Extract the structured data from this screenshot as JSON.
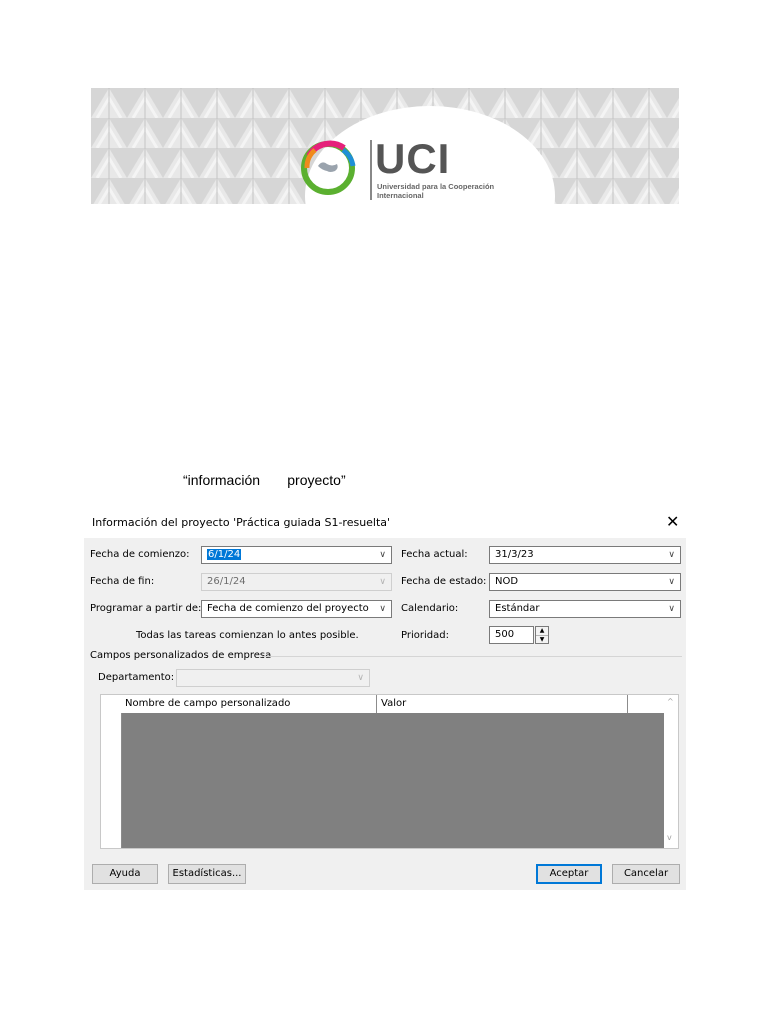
{
  "banner": {
    "logo_text": "UCI",
    "logo_subtitle": "Universidad para la Cooperación Internacional"
  },
  "caption": "“información       proyecto”",
  "dialog": {
    "title": "Información del proyecto 'Práctica guiada S1-resuelta'",
    "close_glyph": "✕",
    "fecha_comienzo": {
      "label": "Fecha de comienzo:",
      "value": "6/1/24"
    },
    "fecha_fin": {
      "label": "Fecha de fin:",
      "value": "26/1/24"
    },
    "programar": {
      "label": "Programar a partir de:",
      "value": "Fecha de comienzo del proyecto"
    },
    "note": "Todas las tareas comienzan lo antes posible.",
    "fecha_actual": {
      "label": "Fecha actual:",
      "value": "31/3/23"
    },
    "fecha_estado": {
      "label": "Fecha de estado:",
      "value": "NOD"
    },
    "calendario": {
      "label": "Calendario:",
      "value": "Estándar"
    },
    "prioridad": {
      "label": "Prioridad:",
      "value": "500"
    },
    "section_title": "Campos personalizados de empresa",
    "departamento": {
      "label": "Departamento:",
      "value": ""
    },
    "grid": {
      "columns": [
        "Nombre de campo personalizado",
        "Valor"
      ],
      "rows": []
    },
    "buttons": {
      "ayuda": "Ayuda",
      "estadisticas": "Estadísticas...",
      "aceptar": "Aceptar",
      "cancelar": "Cancelar"
    }
  },
  "icons": {
    "dropdown": "chevron-down-icon",
    "spin_up": "▲",
    "spin_down": "▼",
    "scroll_up": "^",
    "scroll_down": "v"
  },
  "colors": {
    "selection": "#0078d7",
    "grid_fill": "#808080",
    "dialog_body": "#f0f0f0"
  }
}
